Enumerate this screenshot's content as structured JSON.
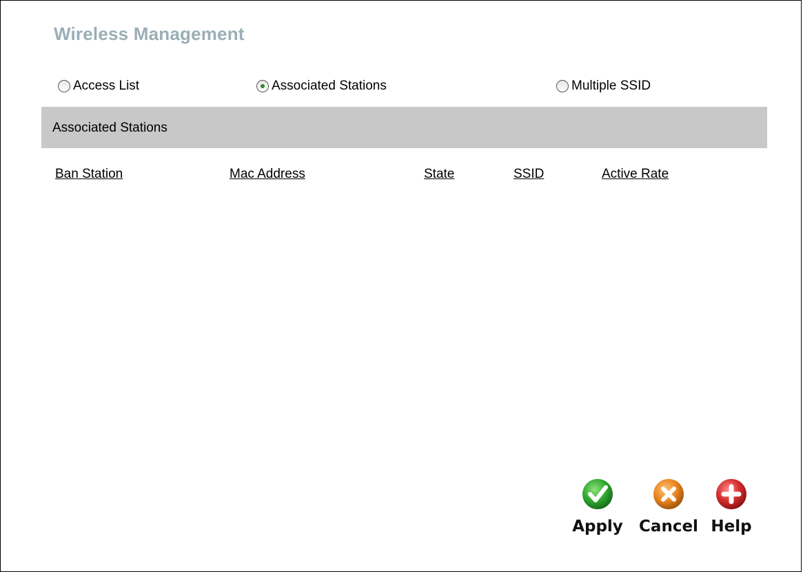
{
  "page": {
    "title": "Wireless Management"
  },
  "tabs": [
    {
      "label": "Access List",
      "selected": false
    },
    {
      "label": "Associated Stations",
      "selected": true
    },
    {
      "label": "Multiple SSID",
      "selected": false
    }
  ],
  "section": {
    "title": "Associated Stations"
  },
  "table": {
    "columns": [
      "Ban Station",
      "Mac Address",
      "State",
      "SSID",
      "Active Rate"
    ],
    "rows": []
  },
  "actions": {
    "apply": {
      "label": "Apply",
      "icon": "check-icon",
      "color": "#2fa82f"
    },
    "cancel": {
      "label": "Cancel",
      "icon": "x-icon",
      "color": "#e8851e"
    },
    "help": {
      "label": "Help",
      "icon": "plus-icon",
      "color": "#d32a2a"
    }
  },
  "colors": {
    "title": "#9aaeb6",
    "section_bar": "#c8c8c8"
  }
}
